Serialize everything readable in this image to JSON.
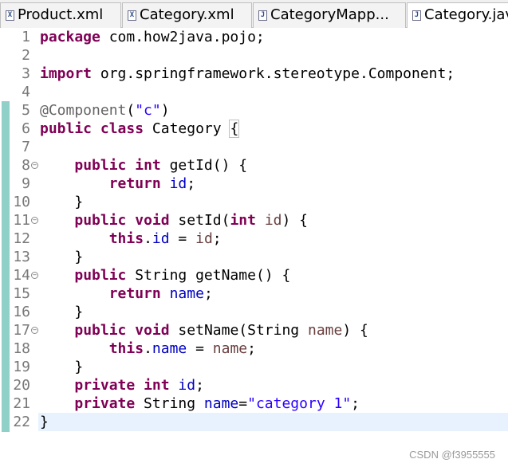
{
  "tabs": [
    {
      "label": "Product.xml",
      "icon": "xml-file-icon",
      "glyph": "X",
      "active": false
    },
    {
      "label": "Category.xml",
      "icon": "xml-file-icon",
      "glyph": "X",
      "active": false
    },
    {
      "label": "CategoryMapp...",
      "icon": "java-file-icon",
      "glyph": "J",
      "active": false
    },
    {
      "label": "Category.jav",
      "icon": "java-file-icon",
      "glyph": "J",
      "active": true
    }
  ],
  "editor": {
    "line_numbers": [
      "1",
      "2",
      "3",
      "4",
      "5",
      "6",
      "7",
      "8",
      "9",
      "10",
      "11",
      "12",
      "13",
      "14",
      "15",
      "16",
      "17",
      "18",
      "19",
      "20",
      "21",
      "22"
    ],
    "fold_lines": [
      8,
      11,
      14,
      17
    ],
    "current_line": 22,
    "code": {
      "l1": {
        "kw": "package",
        "rest": " com.how2java.pojo;"
      },
      "l3": {
        "kw": "import",
        "rest": " org.springframework.stereotype.Component;"
      },
      "l5": {
        "ann": "@Component",
        "open": "(",
        "str": "\"c\"",
        "close": ")"
      },
      "l6": {
        "kw1": "public",
        "kw2": "class",
        "name": " Category ",
        "brace": "{"
      },
      "l8": {
        "indent": "    ",
        "kw1": "public",
        "kw2": "int",
        "rest": " getId() {"
      },
      "l9": {
        "indent": "        ",
        "kw": "return",
        "fld": "id",
        "end": ";"
      },
      "l10": {
        "text": "    }"
      },
      "l11": {
        "indent": "    ",
        "kw1": "public",
        "kw2": "void",
        "mid": " setId(",
        "kw3": "int",
        "par": "id",
        "end": ") {"
      },
      "l12": {
        "indent": "        ",
        "kw": "this",
        "dot": ".",
        "fld": "id",
        "eq": " = ",
        "par": "id",
        "end": ";"
      },
      "l13": {
        "text": "    }"
      },
      "l14": {
        "indent": "    ",
        "kw": "public",
        "rest": " String getName() {"
      },
      "l15": {
        "indent": "        ",
        "kw": "return",
        "fld": "name",
        "end": ";"
      },
      "l16": {
        "text": "    }"
      },
      "l17": {
        "indent": "    ",
        "kw1": "public",
        "kw2": "void",
        "mid": " setName(String ",
        "par": "name",
        "end": ") {"
      },
      "l18": {
        "indent": "        ",
        "kw": "this",
        "dot": ".",
        "fld": "name",
        "eq": " = ",
        "par": "name",
        "end": ";"
      },
      "l19": {
        "text": "    }"
      },
      "l20": {
        "indent": "    ",
        "kw1": "private",
        "kw2": "int",
        "fld": "id",
        "end": ";"
      },
      "l21": {
        "indent": "    ",
        "kw": "private",
        "mid": " String ",
        "fld": "name",
        "eq": "=",
        "str": "\"category 1\"",
        "end": ";"
      },
      "l22": {
        "text": "}"
      }
    }
  },
  "watermark": "CSDN @f3955555",
  "colors": {
    "keyword": "#7f0055",
    "string": "#2a00ff",
    "field": "#0000c0",
    "parameter": "#6a3e3e",
    "annotation": "#646464",
    "quick_diff": "#8fd1c8",
    "current_line": "#e8f2fe"
  }
}
